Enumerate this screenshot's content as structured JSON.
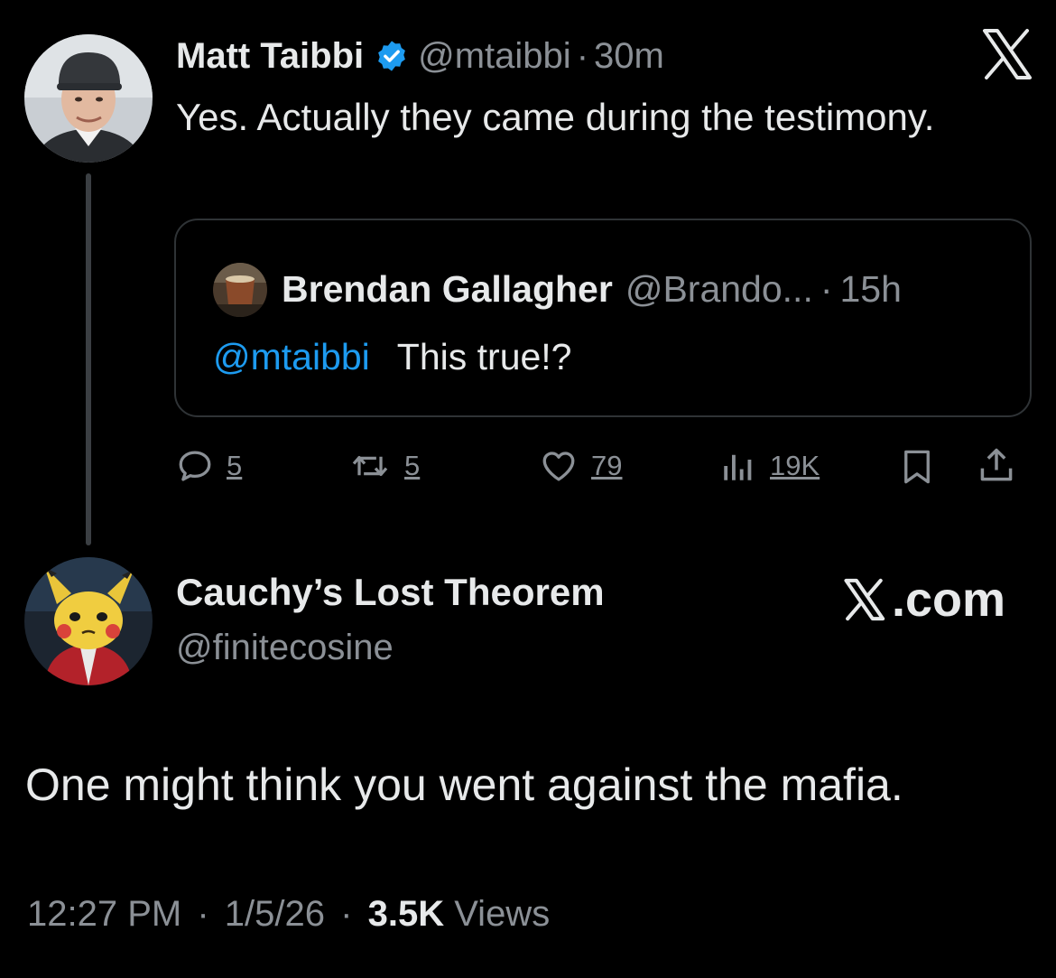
{
  "tweet": {
    "author_name": "Matt Taibbi",
    "handle": "@mtaibbi",
    "separator": "·",
    "time": "30m",
    "verified_icon": "verified-badge-icon",
    "text": "Yes. Actually they came during the testimony."
  },
  "quote": {
    "author_name": "Brendan Gallagher",
    "handle": "@Brando...",
    "separator": "·",
    "time": "15h",
    "mention": "@mtaibbi",
    "text": "This true!?"
  },
  "actions": {
    "replies": "5",
    "reposts": "5",
    "likes": "79",
    "views": "19K"
  },
  "reply": {
    "author_name": "Cauchy’s Lost Theorem",
    "handle": "@finitecosine",
    "brand": ".com",
    "text": "One might think you went against the mafia."
  },
  "meta": {
    "time": "12:27 PM",
    "separator": "·",
    "date": "1/5/26",
    "views_count": "3.5K",
    "views_label": "Views"
  },
  "colors": {
    "background": "#000000",
    "text": "#e7e9ea",
    "muted": "#8b9096",
    "link": "#1d9bf0",
    "border": "#2f3336"
  }
}
